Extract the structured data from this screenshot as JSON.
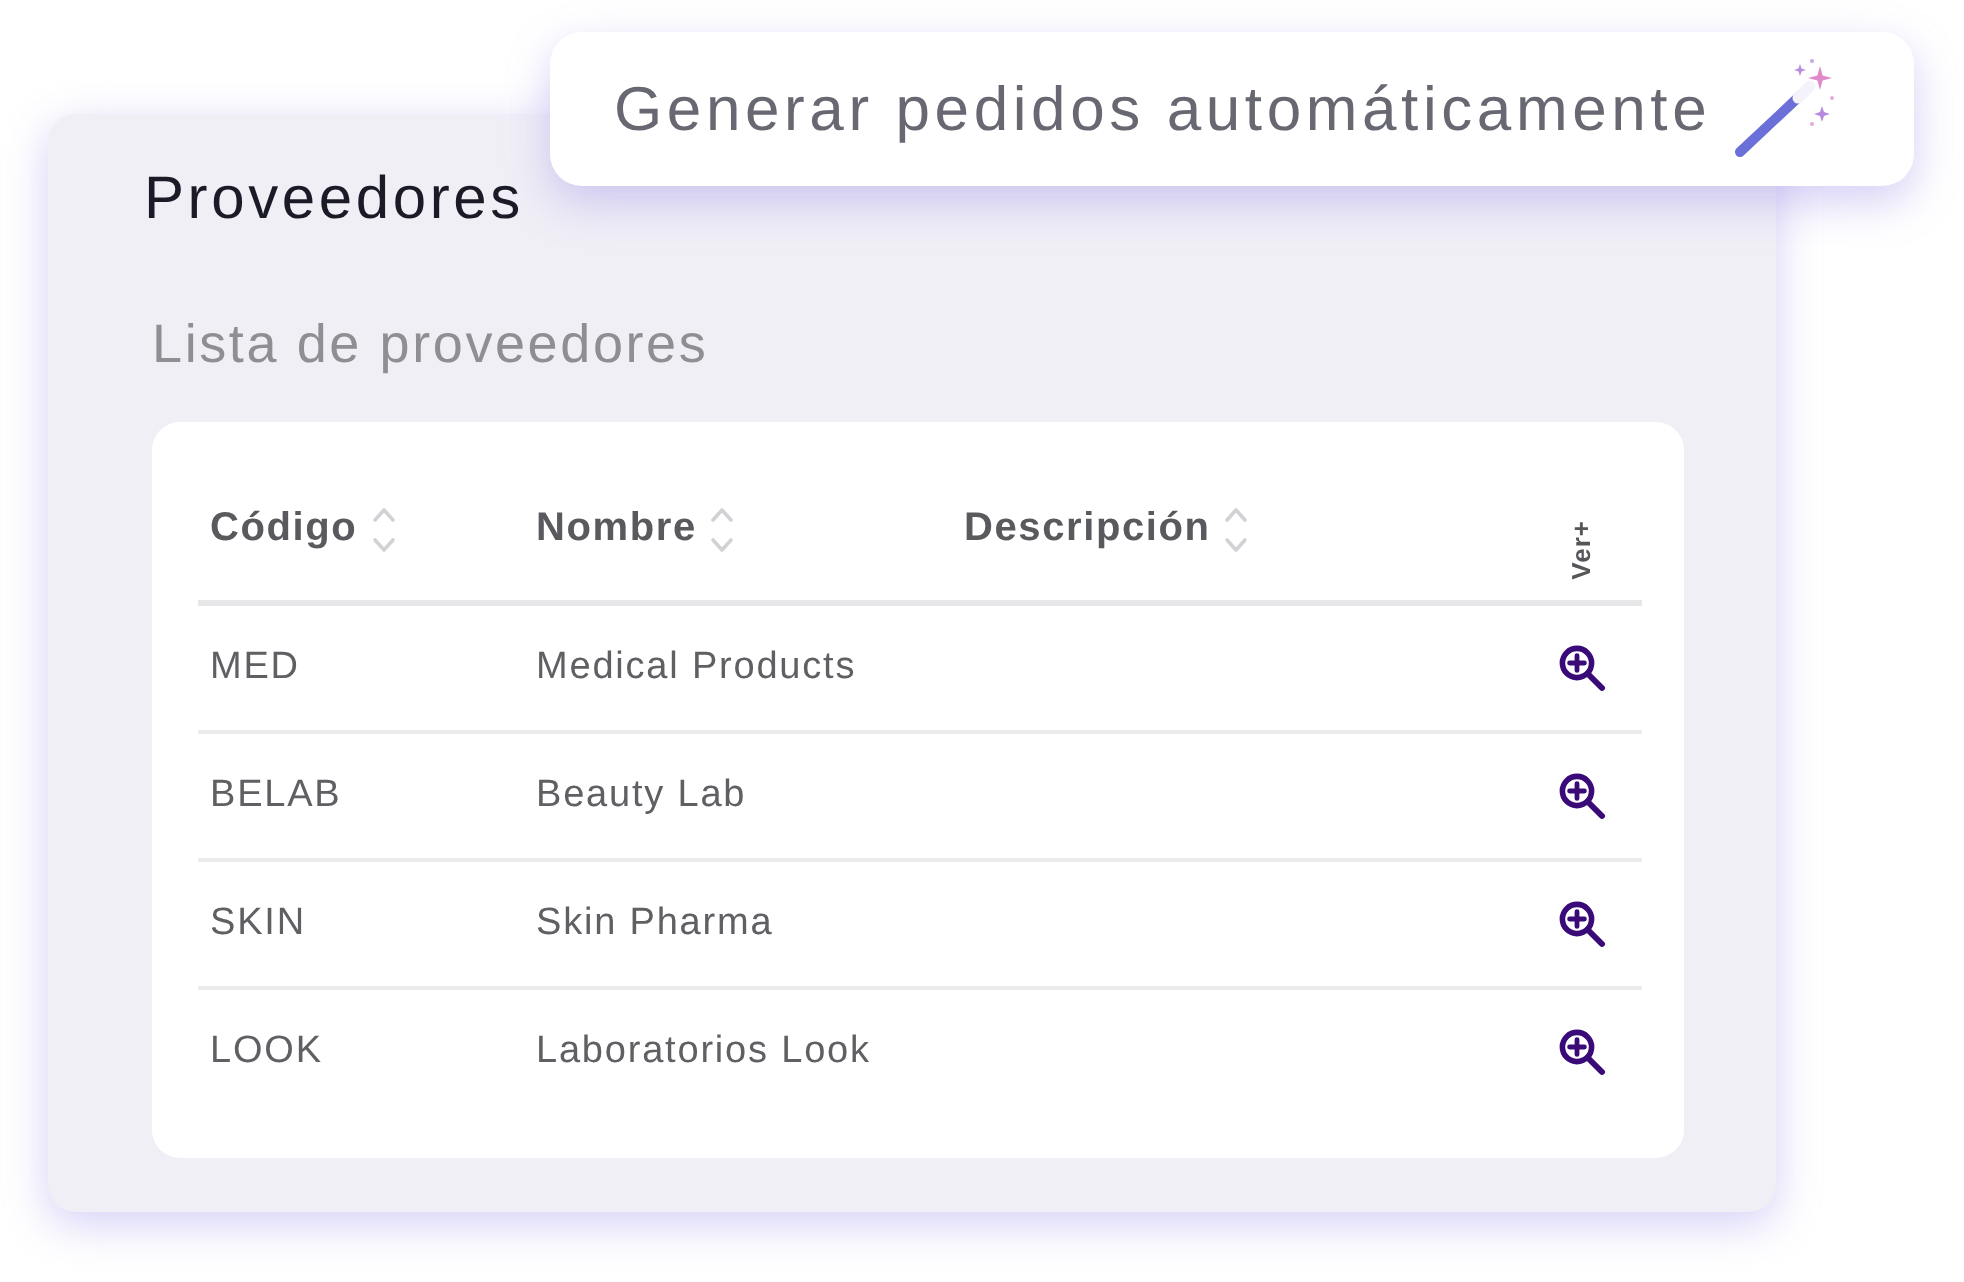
{
  "action_button": {
    "label": "Generar pedidos automáticamente"
  },
  "panel": {
    "title": "Proveedores",
    "subtitle": "Lista de proveedores"
  },
  "table": {
    "columns": [
      {
        "label": "Código",
        "kind": "sortable"
      },
      {
        "label": "Nombre",
        "kind": "sortable"
      },
      {
        "label": "Descripción",
        "kind": "sortable"
      },
      {
        "label": "Ver+",
        "kind": "vertical"
      }
    ],
    "rows": [
      {
        "cells": [
          "MED",
          "Medical Products"
        ]
      },
      {
        "cells": [
          "BELAB",
          "Beauty Lab"
        ]
      },
      {
        "cells": [
          "SKIN",
          "Skin Pharma"
        ]
      },
      {
        "cells": [
          "LOOK",
          "Laboratorios Look"
        ]
      }
    ]
  }
}
